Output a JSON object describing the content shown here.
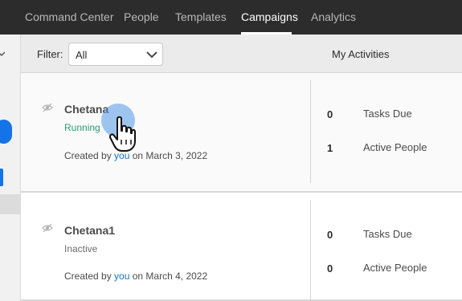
{
  "nav": {
    "tabs": [
      {
        "label": "Command Center",
        "active": false
      },
      {
        "label": "People",
        "active": false
      },
      {
        "label": "Templates",
        "active": false
      },
      {
        "label": "Campaigns",
        "active": true
      },
      {
        "label": "Analytics",
        "active": false
      }
    ]
  },
  "filterbar": {
    "filter_label": "Filter:",
    "filter_value": "All",
    "my_activities": "My Activities"
  },
  "campaigns": [
    {
      "name": "Chetana",
      "status": "Running",
      "created_prefix": "Created by ",
      "created_by": "you",
      "created_suffix": " on March 3, 2022",
      "tasks_due": "0",
      "tasks_due_label": "Tasks Due",
      "active_people": "1",
      "active_people_label": "Active People"
    },
    {
      "name": "Chetana1",
      "status": "Inactive",
      "created_prefix": "Created by ",
      "created_by": "you",
      "created_suffix": " on March 4, 2022",
      "tasks_due": "0",
      "tasks_due_label": "Tasks Due",
      "active_people": "0",
      "active_people_label": "Active People"
    }
  ],
  "icons": {
    "hidden": "eye-off-icon",
    "dropdown": "chevron-down-icon",
    "cursor": "hand-pointer-icon"
  },
  "colors": {
    "nav_bg": "#2c2c2c",
    "accent_blue": "#1473e6",
    "running_green": "#2d9d78"
  }
}
